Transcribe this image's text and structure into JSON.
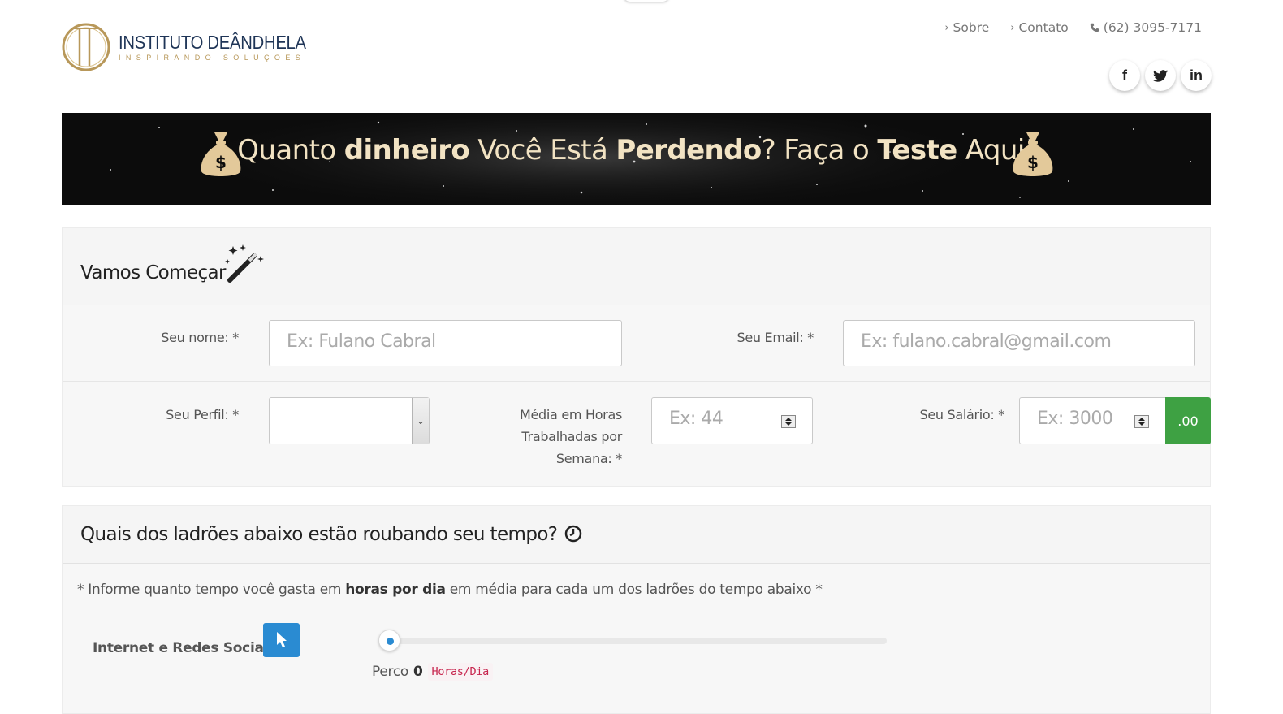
{
  "header": {
    "logo_title": "INSTITUTO DEÂNDHELA",
    "logo_subtitle": "INSPIRANDO SOLUÇÕES",
    "nav": [
      {
        "label": "Sobre"
      },
      {
        "label": "Contato"
      },
      {
        "label": "(62) 3095-7171"
      }
    ],
    "social": [
      {
        "icon": "facebook-icon",
        "glyph": "f"
      },
      {
        "icon": "twitter-icon",
        "glyph": "🐦"
      },
      {
        "icon": "linkedin-icon",
        "glyph": "in"
      }
    ]
  },
  "banner": {
    "part1": "Quanto ",
    "bold1": "dinheiro",
    "part2": " Você Está ",
    "bold2": "Perdendo",
    "part3": "? Faça o ",
    "bold3": "Teste",
    "part4": " Aqui!"
  },
  "form_panel": {
    "title": "Vamos Começar",
    "name": {
      "label": "Seu nome: *",
      "placeholder": "Ex: Fulano Cabral"
    },
    "email": {
      "label": "Seu Email: *",
      "placeholder": "Ex: fulano.cabral@gmail.com"
    },
    "profile": {
      "label": "Seu Perfil: *",
      "value": ""
    },
    "hours": {
      "label_line1": "Média em Horas",
      "label_line2": "Trabalhadas por",
      "label_line3": "Semana: *",
      "placeholder": "Ex: 44"
    },
    "salary": {
      "label": "Seu Salário: *",
      "placeholder": "Ex: 3000",
      "addon": ".00"
    }
  },
  "thieves_panel": {
    "title": "Quais dos ladrões abaixo estão roubando seu tempo?",
    "info_prefix": "* Informe quanto tempo você gasta em ",
    "info_bold": "horas por dia",
    "info_suffix": " em média para cada um dos ladrões do tempo abaixo *",
    "items": [
      {
        "label": "Internet e Redes Sociais",
        "prefix": "Perco",
        "value": "0",
        "unit": "Horas/Dia"
      }
    ]
  },
  "colors": {
    "brand_navy": "#1f3557",
    "brand_gold": "#b8985a",
    "banner_bg": "#0c0c0c",
    "banner_text": "#f2e3c3",
    "addon_green": "#3ea143",
    "accent_blue": "#2a8bd2"
  }
}
